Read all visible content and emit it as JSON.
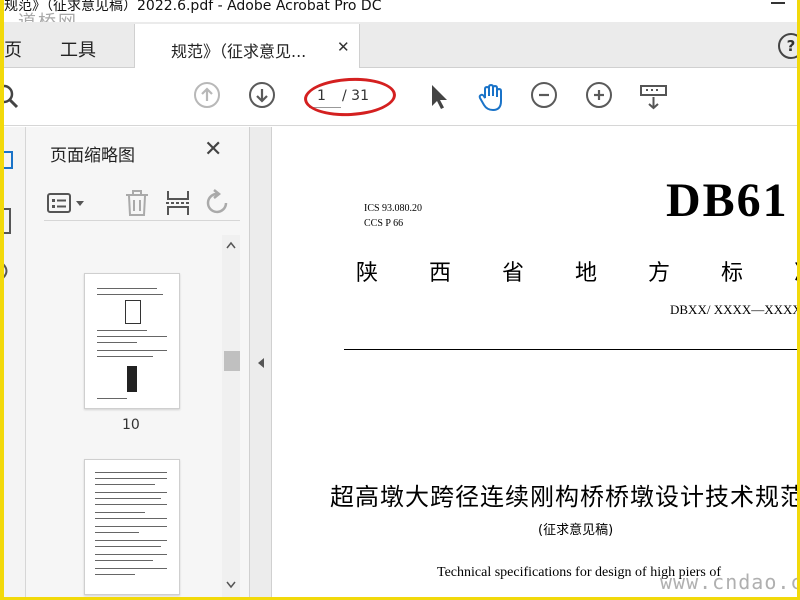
{
  "window": {
    "title": "规范》（征求意见稿）2022.6.pdf - Adobe Acrobat Pro DC",
    "watermark_top": "道桥网"
  },
  "tabs": {
    "home_label": "主页",
    "home_visible": "页",
    "tools_label": "工具",
    "doc_tab_label": "规范》（征求意见...",
    "close_glyph": "✕",
    "help_glyph": "?"
  },
  "toolbar": {
    "page_current": "1",
    "page_total": "/ 31",
    "icons": [
      "search-icon",
      "page-up-icon",
      "page-down-icon",
      "select-cursor-icon",
      "hand-tool-icon",
      "zoom-out-icon",
      "zoom-in-icon",
      "read-mode-icon"
    ],
    "annotation_color": "#d42020",
    "hand_color": "#1a73c8"
  },
  "thumbnail_panel": {
    "title": "页面缩略图",
    "close_glyph": "✕",
    "tools": [
      "options-menu-icon",
      "delete-icon",
      "insert-icon",
      "rotate-icon"
    ],
    "pages": [
      {
        "number": "10"
      },
      {
        "number": ""
      }
    ]
  },
  "document": {
    "ics": "ICS 93.080.20",
    "ccs": "CCS P 66",
    "code": "DB61",
    "province_chars": [
      "陕",
      "西",
      "省",
      "地",
      "方",
      "标",
      "准"
    ],
    "standard_number": "DBXX/ XXXX—XXXX",
    "title": "超高墩大跨径连续刚构桥桥墩设计技术规范",
    "subtitle": "(征求意见稿)",
    "english_title": "Technical specifications for design of high piers of"
  },
  "watermark_bottom": "www.cndao.com"
}
